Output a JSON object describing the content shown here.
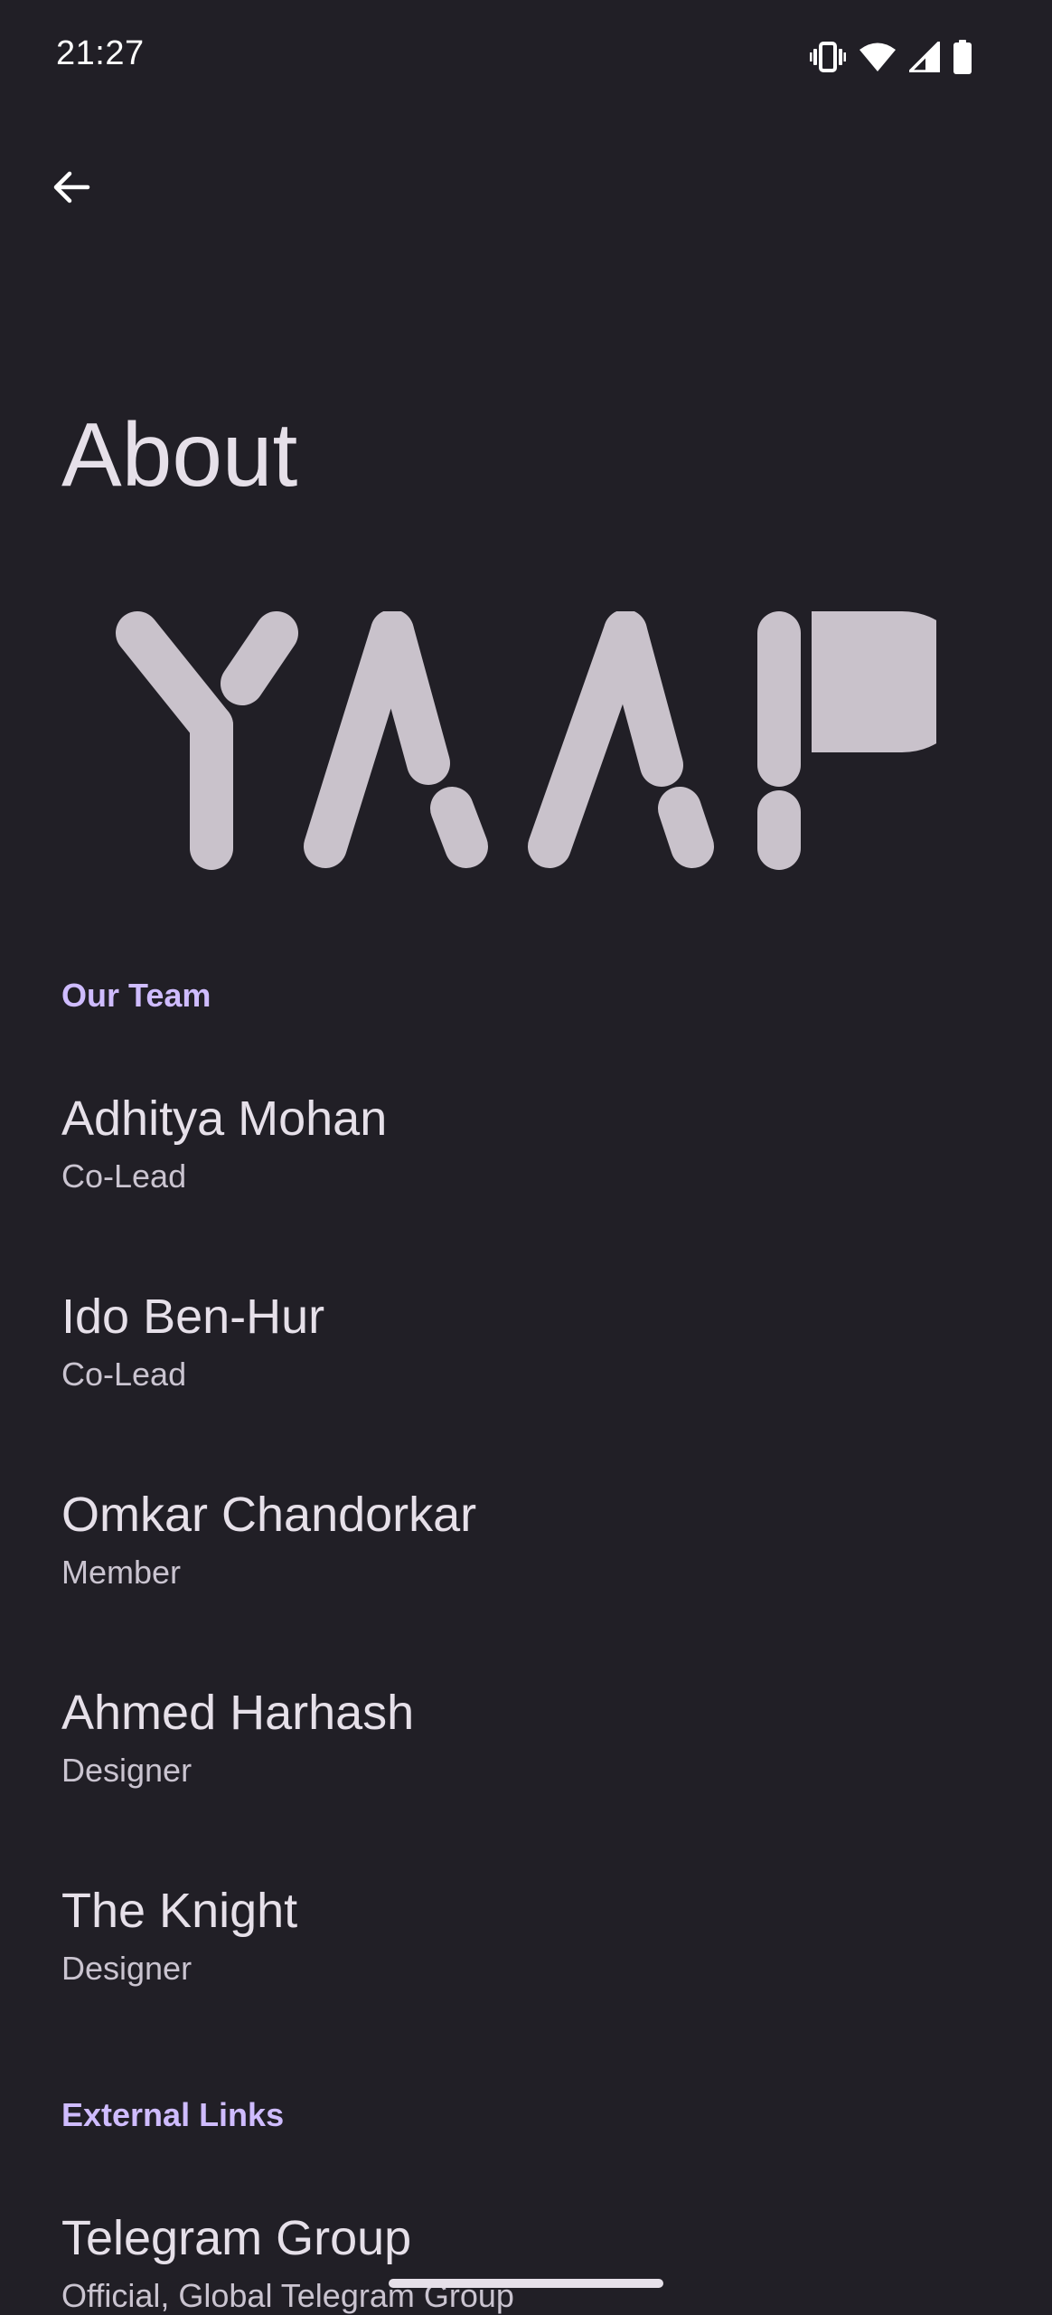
{
  "status_bar": {
    "time": "21:27",
    "icons": [
      "vibrate-icon",
      "wifi-icon",
      "cellular-signal-icon",
      "battery-icon"
    ]
  },
  "toolbar": {
    "back_icon": "arrow-back-icon"
  },
  "page": {
    "title": "About",
    "logo_text": "YAAP"
  },
  "sections": {
    "team": {
      "header": "Our Team",
      "members": [
        {
          "name": "Adhitya Mohan",
          "role": "Co-Lead"
        },
        {
          "name": "Ido Ben-Hur",
          "role": "Co-Lead"
        },
        {
          "name": "Omkar Chandorkar",
          "role": "Member"
        },
        {
          "name": "Ahmed Harhash",
          "role": "Designer"
        },
        {
          "name": "The Knight",
          "role": "Designer"
        }
      ]
    },
    "links": {
      "header": "External Links",
      "items": [
        {
          "title": "Telegram Group",
          "subtitle": "Official, Global Telegram Group"
        }
      ]
    }
  },
  "colors": {
    "background": "#211f26",
    "accent": "#cfbcff",
    "logo": "#c9c2cb",
    "text_primary": "#e6e0e9",
    "text_secondary": "#cac4d0"
  }
}
